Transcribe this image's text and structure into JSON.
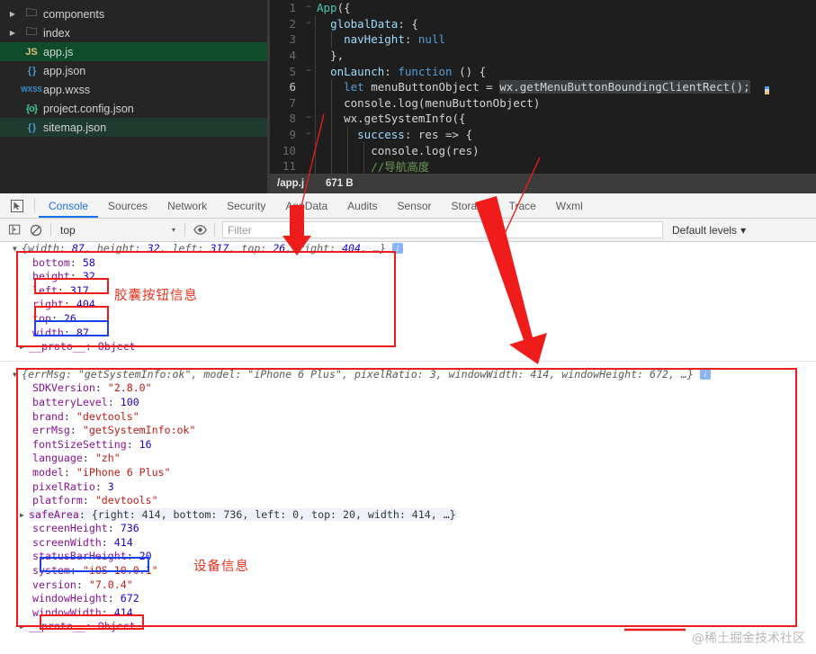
{
  "filetree": {
    "items": [
      {
        "label": "components",
        "icon": "folder-icon",
        "type": "folder",
        "twisty": "▶",
        "state": ""
      },
      {
        "label": "index",
        "icon": "folder-icon",
        "type": "folder",
        "twisty": "▶",
        "state": ""
      },
      {
        "label": "app.js",
        "icon": "js-file-icon",
        "glyph": "JS",
        "type": "js",
        "twisty": "",
        "state": "sel-active"
      },
      {
        "label": "app.json",
        "icon": "json-file-icon",
        "glyph": "{ }",
        "type": "json",
        "twisty": "",
        "state": ""
      },
      {
        "label": "app.wxss",
        "icon": "wxss-file-icon",
        "glyph": "WXSS",
        "type": "wxss",
        "twisty": "",
        "state": ""
      },
      {
        "label": "project.config.json",
        "icon": "config-file-icon",
        "glyph": "{o}",
        "type": "cfg",
        "twisty": "",
        "state": ""
      },
      {
        "label": "sitemap.json",
        "icon": "json-file-icon",
        "glyph": "{ }",
        "type": "json",
        "twisty": "",
        "state": "sel-soft"
      }
    ]
  },
  "editor": {
    "lines": [
      {
        "n": "1",
        "fold": "−",
        "guides": 0,
        "cur": false,
        "tokens": [
          {
            "t": "App",
            "c": "tk-fn"
          },
          {
            "t": "({",
            "c": "tk-plain"
          }
        ]
      },
      {
        "n": "2",
        "fold": "−",
        "guides": 1,
        "cur": false,
        "tokens": [
          {
            "t": "  ",
            "c": "tk-plain"
          },
          {
            "t": "globalData",
            "c": "tk-prop"
          },
          {
            "t": ": {",
            "c": "tk-plain"
          }
        ]
      },
      {
        "n": "3",
        "fold": "",
        "guides": 2,
        "cur": false,
        "tokens": [
          {
            "t": "    ",
            "c": "tk-plain"
          },
          {
            "t": "navHeight",
            "c": "tk-prop"
          },
          {
            "t": ": ",
            "c": "tk-plain"
          },
          {
            "t": "null",
            "c": "tk-kw"
          }
        ]
      },
      {
        "n": "4",
        "fold": "",
        "guides": 1,
        "cur": false,
        "tokens": [
          {
            "t": "  },",
            "c": "tk-plain"
          }
        ]
      },
      {
        "n": "5",
        "fold": "−",
        "guides": 1,
        "cur": false,
        "tokens": [
          {
            "t": "  ",
            "c": "tk-plain"
          },
          {
            "t": "onLaunch",
            "c": "tk-prop"
          },
          {
            "t": ": ",
            "c": "tk-plain"
          },
          {
            "t": "function",
            "c": "tk-kw"
          },
          {
            "t": " () {",
            "c": "tk-plain"
          }
        ]
      },
      {
        "n": "6",
        "fold": "",
        "guides": 2,
        "cur": true,
        "tokens": [
          {
            "t": "    ",
            "c": "tk-plain"
          },
          {
            "t": "let",
            "c": "tk-kw"
          },
          {
            "t": " menuButtonObject = ",
            "c": "tk-plain"
          },
          {
            "t": "wx.getMenuButtonBoundingClientRect();",
            "c": "tk-plain tk-hl"
          }
        ]
      },
      {
        "n": "7",
        "fold": "",
        "guides": 2,
        "cur": false,
        "tokens": [
          {
            "t": "    console.log(menuButtonObject)",
            "c": "tk-plain"
          }
        ]
      },
      {
        "n": "8",
        "fold": "−",
        "guides": 2,
        "cur": false,
        "tokens": [
          {
            "t": "    wx.getSystemInfo({",
            "c": "tk-plain"
          }
        ]
      },
      {
        "n": "9",
        "fold": "−",
        "guides": 3,
        "cur": false,
        "tokens": [
          {
            "t": "      ",
            "c": "tk-plain"
          },
          {
            "t": "success",
            "c": "tk-prop"
          },
          {
            "t": ": res => {",
            "c": "tk-plain"
          }
        ]
      },
      {
        "n": "10",
        "fold": "",
        "guides": 4,
        "cur": false,
        "tokens": [
          {
            "t": "        console.log(res)",
            "c": "tk-plain"
          }
        ]
      },
      {
        "n": "11",
        "fold": "",
        "guides": 4,
        "cur": false,
        "tokens": [
          {
            "t": "        ",
            "c": "tk-plain"
          },
          {
            "t": "//导航高度",
            "c": "tk-cmt"
          }
        ]
      }
    ],
    "status": {
      "path": "/app.j",
      "size": "671 B"
    }
  },
  "devtools": {
    "inspect_icon": "inspect-element-icon",
    "tabs": [
      {
        "label": "Console",
        "active": true
      },
      {
        "label": "Sources",
        "active": false
      },
      {
        "label": "Network",
        "active": false
      },
      {
        "label": "Security",
        "active": false
      },
      {
        "label": "AppData",
        "active": false
      },
      {
        "label": "Audits",
        "active": false
      },
      {
        "label": "Sensor",
        "active": false
      },
      {
        "label": "Storage",
        "active": false
      },
      {
        "label": "Trace",
        "active": false
      },
      {
        "label": "Wxml",
        "active": false
      }
    ],
    "filterbar": {
      "sidebar_icon": "show-console-sidebar-icon",
      "clear_icon": "clear-console-icon",
      "context": "top",
      "context_caret": "▾",
      "eye_icon": "live-expression-icon",
      "filter_placeholder": "Filter",
      "levels": "Default levels",
      "levels_caret": "▾"
    }
  },
  "console": {
    "entry1": {
      "summary_prefix": "{",
      "summary": [
        {
          "k": "width",
          "v": "87",
          "kind": "num"
        },
        {
          "k": "height",
          "v": "32",
          "kind": "num"
        },
        {
          "k": "left",
          "v": "317",
          "kind": "num"
        },
        {
          "k": "top",
          "v": "26",
          "kind": "num"
        },
        {
          "k": "right",
          "v": "404",
          "kind": "num"
        }
      ],
      "summary_suffix": ", …}",
      "props": [
        {
          "k": "bottom",
          "v": "58",
          "kind": "num",
          "hl": ""
        },
        {
          "k": "height",
          "v": "32",
          "kind": "num",
          "hl": "red"
        },
        {
          "k": "left",
          "v": "317",
          "kind": "num",
          "hl": ""
        },
        {
          "k": "right",
          "v": "404",
          "kind": "num",
          "hl": "red"
        },
        {
          "k": "top",
          "v": "26",
          "kind": "num",
          "hl": "blue"
        },
        {
          "k": "width",
          "v": "87",
          "kind": "num",
          "hl": ""
        }
      ],
      "proto": "__proto__: Object"
    },
    "entry2": {
      "summary": "{errMsg: \"getSystemInfo:ok\", model: \"iPhone 6 Plus\", pixelRatio: 3, windowWidth: 414, windowHeight: 672, …}",
      "props": [
        {
          "k": "SDKVersion",
          "v": "\"2.8.0\"",
          "kind": "str",
          "hl": ""
        },
        {
          "k": "batteryLevel",
          "v": "100",
          "kind": "num",
          "hl": ""
        },
        {
          "k": "brand",
          "v": "\"devtools\"",
          "kind": "str",
          "hl": ""
        },
        {
          "k": "errMsg",
          "v": "\"getSystemInfo:ok\"",
          "kind": "str",
          "hl": ""
        },
        {
          "k": "fontSizeSetting",
          "v": "16",
          "kind": "num",
          "hl": ""
        },
        {
          "k": "language",
          "v": "\"zh\"",
          "kind": "str",
          "hl": ""
        },
        {
          "k": "model",
          "v": "\"iPhone 6 Plus\"",
          "kind": "str",
          "hl": ""
        },
        {
          "k": "pixelRatio",
          "v": "3",
          "kind": "num",
          "hl": ""
        },
        {
          "k": "platform",
          "v": "\"devtools\"",
          "kind": "str",
          "hl": ""
        },
        {
          "k": "safeArea",
          "v": "{right: 414, bottom: 736, left: 0, top: 20, width: 414, …}",
          "kind": "obj",
          "hl": "",
          "expandable": true
        },
        {
          "k": "screenHeight",
          "v": "736",
          "kind": "num",
          "hl": ""
        },
        {
          "k": "screenWidth",
          "v": "414",
          "kind": "num",
          "hl": ""
        },
        {
          "k": "statusBarHeight",
          "v": "20",
          "kind": "num",
          "hl": "blue"
        },
        {
          "k": "system",
          "v": "\"iOS 10.0.1\"",
          "kind": "str",
          "hl": ""
        },
        {
          "k": "version",
          "v": "\"7.0.4\"",
          "kind": "str",
          "hl": ""
        },
        {
          "k": "windowHeight",
          "v": "672",
          "kind": "num",
          "hl": ""
        },
        {
          "k": "windowWidth",
          "v": "414",
          "kind": "num",
          "hl": "red"
        }
      ],
      "proto": "__proto__: Object"
    }
  },
  "annotations": {
    "label_capsule": "胶囊按钮信息",
    "label_device": "设备信息",
    "watermark": "@稀土掘金技术社区"
  },
  "colors": {
    "annotation_red": "#f01c1c",
    "annotation_blue": "#1c3ff0",
    "accent_blue": "#1a73e8",
    "editor_bg": "#1e1e1e",
    "tree_bg": "#252526",
    "selected_file": "#0f4c2c"
  }
}
